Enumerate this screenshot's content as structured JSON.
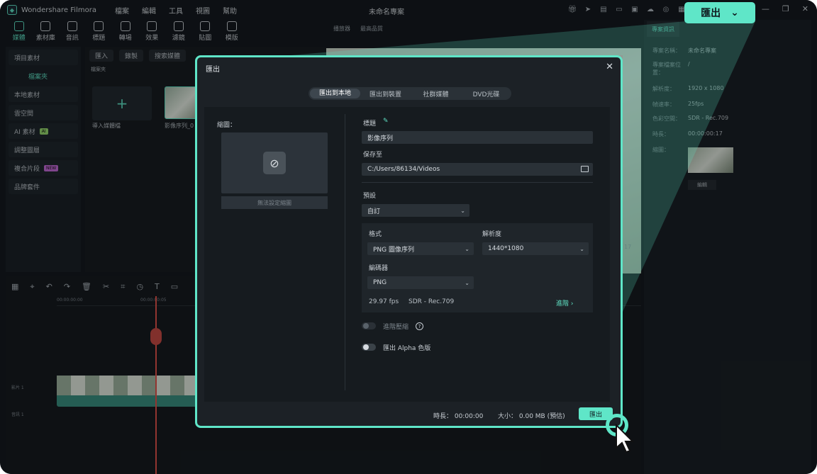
{
  "titlebar": {
    "app_name": "Wondershare Filmora",
    "menu": [
      "檔案",
      "編輯",
      "工具",
      "視圖",
      "幫助"
    ],
    "doc_title": "未命名專案",
    "export_label": "匯出"
  },
  "toolbar": {
    "tools": [
      "媒體",
      "素材庫",
      "音訊",
      "標題",
      "轉場",
      "效果",
      "濾鏡",
      "貼圖",
      "模版"
    ]
  },
  "left_panel": {
    "items": [
      {
        "label": "項目素材",
        "badge": ""
      },
      {
        "label": "檔案夾",
        "badge": ""
      },
      {
        "label": "本地素材",
        "badge": ""
      },
      {
        "label": "雲空間",
        "badge": ""
      },
      {
        "label": "AI 素材",
        "badge": "AI"
      },
      {
        "label": "調整圖層",
        "badge": ""
      },
      {
        "label": "複合片段",
        "badge": "NEW"
      },
      {
        "label": "品牌套件",
        "badge": ""
      }
    ]
  },
  "media": {
    "import_label": "匯入",
    "record_label": "錄製",
    "search_placeholder": "搜索媒體",
    "folder_label": "檔案夾",
    "import_media": "導入媒體檔",
    "clip_name": "影像序列_0"
  },
  "player": {
    "label": "播放器",
    "quality": "最高品質",
    "time_partial": "17"
  },
  "properties": {
    "tab": "專案資訊",
    "rows": [
      {
        "k": "專案名稱：",
        "v": "未命名專案"
      },
      {
        "k": "專案檔案位置：",
        "v": "/"
      },
      {
        "k": "解析度：",
        "v": "1920 x 1080"
      },
      {
        "k": "幀速率：",
        "v": "25fps"
      },
      {
        "k": "色彩空間：",
        "v": "SDR - Rec.709"
      },
      {
        "k": "時長：",
        "v": "00:00:00:17"
      },
      {
        "k": "縮圖：",
        "v": ""
      }
    ],
    "edit_label": "編輯"
  },
  "timeline": {
    "time_start": "00:00:00:00",
    "time_mid": "00:00:00:05",
    "video_track": "影片 1",
    "audio_track": "音訊 1"
  },
  "dialog": {
    "title": "匯出",
    "close": "✕",
    "tabs": [
      "匯出到本地",
      "匯出到裝置",
      "社群媒體",
      "DVD光碟"
    ],
    "thumbnail_label": "縮圖：",
    "thumbnail_btn": "無法設定縮圖",
    "title_label": "標題",
    "title_value": "影像序列",
    "save_to_label": "保存至",
    "save_to_value": "C:/Users/86134/Videos",
    "preset_label": "預設",
    "preset_value": "自訂",
    "format_label": "格式",
    "format_value": "PNG 圖像序列",
    "resolution_label": "解析度",
    "resolution_value": "1440*1080",
    "encoder_label": "編碼器",
    "encoder_value": "PNG",
    "fps": "29.97 fps",
    "color_space": "SDR - Rec.709",
    "advanced_label": "進階",
    "advanced_compress_label": "進階壓縮",
    "export_alpha_label": "匯出 Alpha 色版",
    "duration_label": "時長：",
    "duration_value": "00:00:00",
    "size_label": "大小：",
    "size_value": "0.00 MB (預估)",
    "export_button": "匯出"
  }
}
